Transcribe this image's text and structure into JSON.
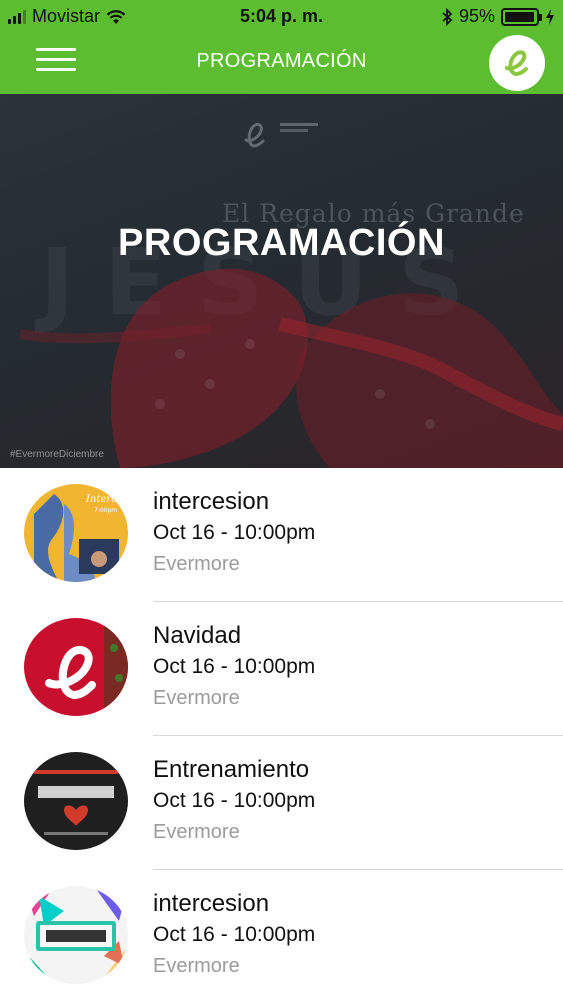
{
  "status_bar": {
    "carrier": "Movistar",
    "time": "5:04 p. m.",
    "battery_percent": "95%",
    "battery_level": 0.95
  },
  "nav": {
    "title": "PROGRAMACIÓN",
    "menu_icon": "hamburger-menu-icon",
    "logo_icon": "evermore-logo-icon",
    "accent_color": "#5cbd31"
  },
  "hero": {
    "title": "PROGRAMACIÓN",
    "subtitle": "El Regalo más Grande",
    "hashtag": "#EvermoreDiciembre"
  },
  "events": [
    {
      "name": "intercesion",
      "date": "Oct 16 - 10:00pm",
      "organizer": "Evermore",
      "thumb": "intercesion-thumbnail"
    },
    {
      "name": "Navidad",
      "date": "Oct 16 - 10:00pm",
      "organizer": "Evermore",
      "thumb": "navidad-thumbnail"
    },
    {
      "name": "Entrenamiento",
      "date": "Oct 16 - 10:00pm",
      "organizer": "Evermore",
      "thumb": "entrenamiento-thumbnail"
    },
    {
      "name": "intercesion",
      "date": "Oct 16 - 10:00pm",
      "organizer": "Evermore",
      "thumb": "corre-thumbnail"
    }
  ]
}
